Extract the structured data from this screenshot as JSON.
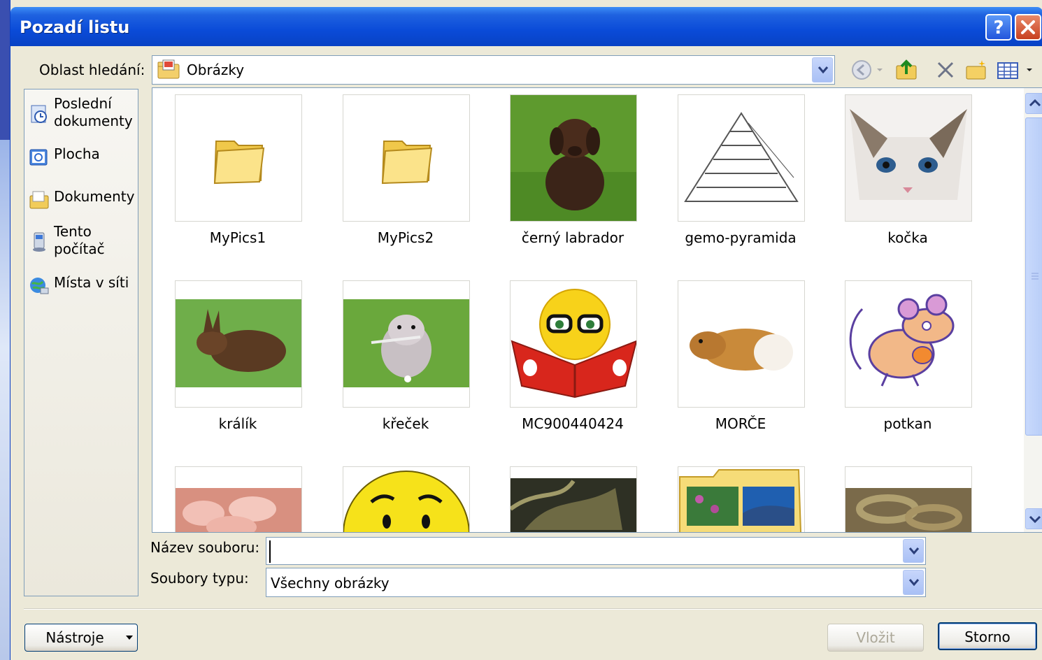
{
  "window": {
    "title": "Pozadí listu",
    "help_label": "?",
    "close_label": "✕"
  },
  "lookin": {
    "label": "Oblast hledání:",
    "value": "Obrázky"
  },
  "toolbar": [
    "back-icon",
    "up-folder-icon",
    "delete-icon",
    "new-folder-icon",
    "views-icon"
  ],
  "places": [
    {
      "label": "Poslední dokumenty",
      "icon": "recent-documents-icon"
    },
    {
      "label": "Plocha",
      "icon": "desktop-icon"
    },
    {
      "label": "Dokumenty",
      "icon": "documents-icon"
    },
    {
      "label": "Tento počítač",
      "icon": "computer-icon"
    },
    {
      "label": "Místa v síti",
      "icon": "network-icon"
    }
  ],
  "files": [
    {
      "name": "MyPics1",
      "kind": "folder"
    },
    {
      "name": "MyPics2",
      "kind": "folder"
    },
    {
      "name": "černý labrador",
      "kind": "image"
    },
    {
      "name": "gemo-pyramida",
      "kind": "image"
    },
    {
      "name": "kočka",
      "kind": "image"
    },
    {
      "name": "králík",
      "kind": "image"
    },
    {
      "name": "křeček",
      "kind": "image"
    },
    {
      "name": "MC900440424",
      "kind": "image"
    },
    {
      "name": "MORČE",
      "kind": "image"
    },
    {
      "name": "potkan",
      "kind": "image"
    }
  ],
  "filename": {
    "label": "Název souboru:",
    "value": ""
  },
  "filetype": {
    "label": "Soubory typu:",
    "value": "Všechny obrázky"
  },
  "buttons": {
    "tools": "Nástroje",
    "insert": "Vložit",
    "cancel": "Storno"
  },
  "colors": {
    "titlebar": "#0a4bd8",
    "dialog": "#ece9d8",
    "folder": "#f5d870"
  }
}
